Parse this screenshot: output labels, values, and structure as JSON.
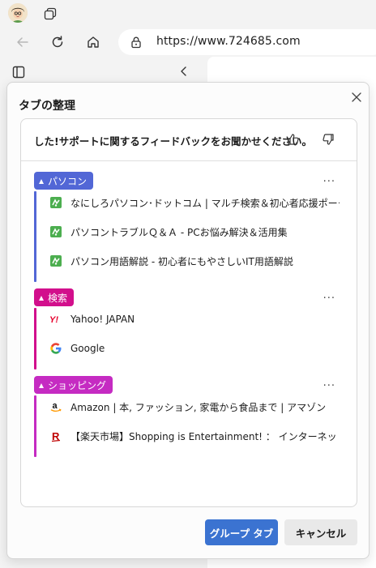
{
  "browser": {
    "url": "https://www.724685.com",
    "icons": [
      "avatar",
      "tab-actions-icon",
      "back-icon",
      "refresh-icon",
      "home-icon",
      "lock-icon",
      "sidepanel-icon",
      "chevron-left-icon"
    ]
  },
  "dialog": {
    "title": "タブの整理",
    "feedback_text": "した!サポートに関するフィードバックをお聞かせください。",
    "groups": [
      {
        "name": "パソコン",
        "color": "#5267d6",
        "tabs": [
          {
            "title": "なにしろパソコン･ドットコム | マルチ検索＆初心者応援ポータルサイト",
            "icon": "green-site-icon"
          },
          {
            "title": "パソコントラブルＱ＆Ａ - PCお悩み解決＆活用集",
            "icon": "green-site-icon"
          },
          {
            "title": "パソコン用語解説 - 初心者にもやさしいIT用語解説",
            "icon": "green-site-icon"
          }
        ]
      },
      {
        "name": "検索",
        "color": "#d20f8c",
        "tabs": [
          {
            "title": "Yahoo! JAPAN",
            "icon": "yahoo-icon"
          },
          {
            "title": "Google",
            "icon": "google-icon"
          }
        ]
      },
      {
        "name": "ショッピング",
        "color": "#c52bc2",
        "tabs": [
          {
            "title": "Amazon | 本, ファッション, 家電から食品まで | アマゾン",
            "icon": "amazon-icon"
          },
          {
            "title": "【楽天市場】Shopping is Entertainment! ： インターネット最大級の",
            "icon": "rakuten-icon"
          }
        ]
      }
    ],
    "more_label": "...",
    "primary_button": "グループ タブ",
    "secondary_button": "キャンセル"
  }
}
